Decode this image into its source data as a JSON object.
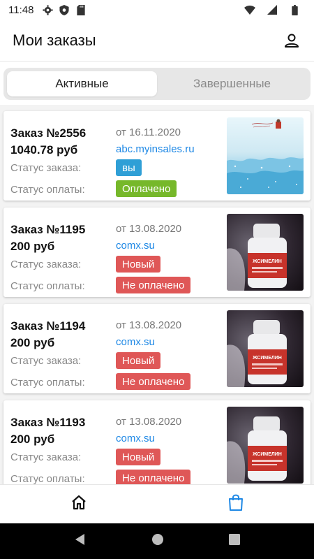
{
  "status_bar": {
    "time": "11:48"
  },
  "header": {
    "title": "Мои заказы"
  },
  "tabs": [
    {
      "label": "Активные",
      "active": true
    },
    {
      "label": "Завершенные",
      "active": false
    }
  ],
  "labels": {
    "order_status": "Статус заказа:",
    "payment_status": "Статус оплаты:"
  },
  "orders": [
    {
      "number": "Заказ №2556",
      "price": "1040.78 руб",
      "date": "от 16.11.2020",
      "shop": "abc.myinsales.ru",
      "status": "вы",
      "status_color": "#2f9fd6",
      "payment": "Оплачено",
      "payment_color": "#76b82a",
      "image": "winter-card-image"
    },
    {
      "number": "Заказ №1195",
      "price": "200 руб",
      "date": "от 13.08.2020",
      "shop": "comx.su",
      "status": "Новый",
      "status_color": "#df5757",
      "payment": "Не оплачено",
      "payment_color": "#df5757",
      "image": "product-bottle-image"
    },
    {
      "number": "Заказ №1194",
      "price": "200 руб",
      "date": "от 13.08.2020",
      "shop": "comx.su",
      "status": "Новый",
      "status_color": "#df5757",
      "payment": "Не оплачено",
      "payment_color": "#df5757",
      "image": "product-bottle-image"
    },
    {
      "number": "Заказ №1193",
      "price": "200 руб",
      "date": "от 13.08.2020",
      "shop": "comx.su",
      "status": "Новый",
      "status_color": "#df5757",
      "payment": "Не оплачено",
      "payment_color": "#df5757",
      "image": "product-bottle-image"
    }
  ],
  "bottom_nav": [
    {
      "icon": "home-icon",
      "active": false
    },
    {
      "icon": "shopping-bag-icon",
      "active": true,
      "color": "#1e88e5"
    }
  ]
}
